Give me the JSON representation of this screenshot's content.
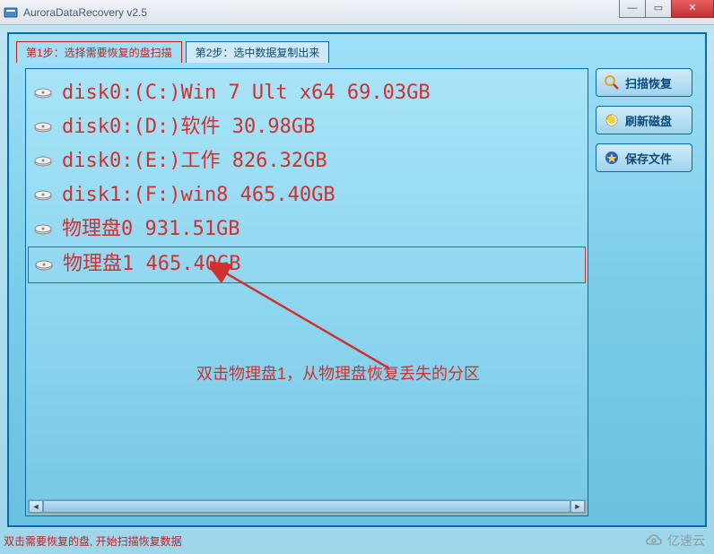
{
  "window": {
    "title": "AuroraDataRecovery v2.5"
  },
  "tabs": {
    "step1": "第1步：选择需要恢复的盘扫描",
    "step2": "第2步：选中数据复制出来"
  },
  "disks": [
    {
      "label": "disk0:(C:)Win 7 Ult x64 69.03GB"
    },
    {
      "label": "disk0:(D:)软件 30.98GB"
    },
    {
      "label": "disk0:(E:)工作 826.32GB"
    },
    {
      "label": "disk1:(F:)win8 465.40GB"
    },
    {
      "label": "物理盘0 931.51GB"
    },
    {
      "label": "物理盘1 465.40GB"
    }
  ],
  "annotation": "双击物理盘1，从物理盘恢复丢失的分区",
  "buttons": {
    "scan": "扫描恢复",
    "refresh": "刷新磁盘",
    "save": "保存文件"
  },
  "status": "双击需要恢复的盘, 开始扫描恢复数据",
  "watermark": "亿速云",
  "icons": {
    "app": "app-icon",
    "disk": "disk-icon",
    "scan": "magnifier-icon",
    "refresh": "refresh-icon",
    "save": "star-icon"
  }
}
